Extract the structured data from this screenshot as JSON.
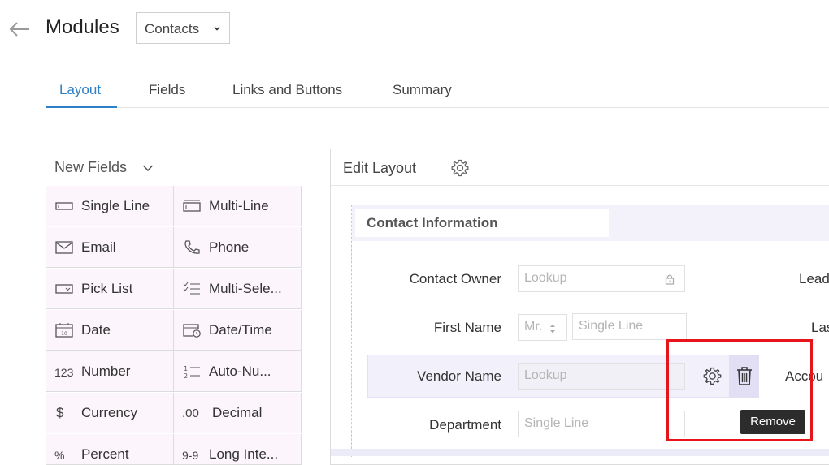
{
  "header": {
    "title": "Modules",
    "module_select": "Contacts"
  },
  "tabs": [
    {
      "label": "Layout",
      "active": true
    },
    {
      "label": "Fields"
    },
    {
      "label": "Links and Buttons"
    },
    {
      "label": "Summary"
    }
  ],
  "new_fields": {
    "title": "New Fields",
    "items": [
      {
        "label": "Single Line",
        "icon": "single-line-icon"
      },
      {
        "label": "Multi-Line",
        "icon": "multi-line-icon"
      },
      {
        "label": "Email",
        "icon": "email-icon"
      },
      {
        "label": "Phone",
        "icon": "phone-icon"
      },
      {
        "label": "Pick List",
        "icon": "pick-list-icon"
      },
      {
        "label": "Multi-Sele...",
        "icon": "multi-select-icon"
      },
      {
        "label": "Date",
        "icon": "date-icon"
      },
      {
        "label": "Date/Time",
        "icon": "date-time-icon"
      },
      {
        "label": "Number",
        "icon_text": "123"
      },
      {
        "label": "Auto-Nu...",
        "icon": "auto-number-icon"
      },
      {
        "label": "Currency",
        "icon_text": "$"
      },
      {
        "label": "Decimal",
        "icon_text": ".00"
      },
      {
        "label": "Percent",
        "icon_text": "%"
      },
      {
        "label": "Long Inte...",
        "icon_text": "9-9"
      }
    ]
  },
  "edit_layout": {
    "title": "Edit Layout",
    "section_title": "Contact Information",
    "fields": [
      {
        "label": "Contact Owner",
        "placeholder": "Lookup"
      },
      {
        "label": "First Name",
        "salutation": "Mr.",
        "placeholder": "Single Line"
      },
      {
        "label": "Vendor Name",
        "placeholder": "Lookup"
      },
      {
        "label": "Department",
        "placeholder": "Single Line"
      }
    ],
    "right_labels": [
      "Lead",
      "Las",
      "Accou"
    ]
  },
  "tooltip": "Remove",
  "colors": {
    "accent": "#2f7fc6",
    "highlight_border": "#e8141b",
    "cell_bg": "#fcf5fb"
  }
}
